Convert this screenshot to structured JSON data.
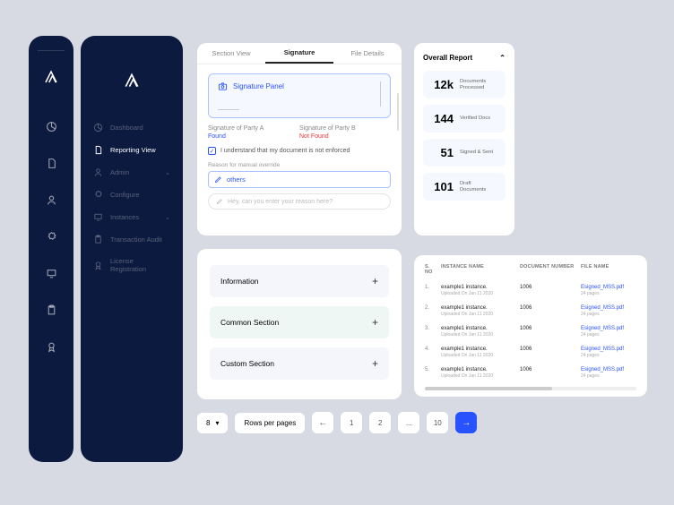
{
  "sidebar": {
    "items": [
      {
        "label": "Dashboard"
      },
      {
        "label": "Reporting View"
      },
      {
        "label": "Admin"
      },
      {
        "label": "Configure"
      },
      {
        "label": "Instances"
      },
      {
        "label": "Transaction Audit"
      },
      {
        "label": "License Registration"
      }
    ]
  },
  "signature": {
    "tabs": {
      "section": "Section View",
      "signature": "Signature",
      "file": "File Details"
    },
    "panel_label": "Signature Panel",
    "partyA_label": "Signature of Party A",
    "partyA_value": "Found",
    "partyB_label": "Signature of Party B",
    "partyB_value": "Not Found",
    "consent": "I understand that my document is not enforced",
    "reason_label": "Reason for manual override",
    "reason_value": "others",
    "comment_placeholder": "Hey, can you enter your reason here?"
  },
  "report": {
    "title": "Overall Report",
    "stats": [
      {
        "value": "12k",
        "label": "Documents Processed"
      },
      {
        "value": "144",
        "label": "Verified Docs"
      },
      {
        "value": "51",
        "label": "Signed & Sent"
      },
      {
        "value": "101",
        "label": "Draft Documents"
      }
    ]
  },
  "accordion": [
    {
      "label": "Information"
    },
    {
      "label": "Common Section"
    },
    {
      "label": "Custom Section"
    }
  ],
  "table": {
    "headers": {
      "sno": "S. NO",
      "instance": "INSTANCE NAME",
      "docnum": "DOCUMENT NUMBER",
      "filename": "FILE NAME"
    },
    "rows": [
      {
        "n": "1.",
        "name": "example1 instance.",
        "sub": "Uploaded On Jan 11 2020",
        "doc": "1006",
        "file": "Esigned_MSS.pdf",
        "pages": "24 pages"
      },
      {
        "n": "2.",
        "name": "example1 instance.",
        "sub": "Uploaded On Jan 11 2020",
        "doc": "1006",
        "file": "Esigned_MSS.pdf",
        "pages": "24 pages"
      },
      {
        "n": "3.",
        "name": "example1 instance.",
        "sub": "Uploaded On Jan 11 2020",
        "doc": "1006",
        "file": "Esigned_MSS.pdf",
        "pages": "24 pages"
      },
      {
        "n": "4.",
        "name": "example1 instance.",
        "sub": "Uploaded On Jan 11 2020",
        "doc": "1006",
        "file": "Esigned_MSS.pdf",
        "pages": "24 pages"
      },
      {
        "n": "5.",
        "name": "example1 instance.",
        "sub": "Uploaded On Jan 11 2020",
        "doc": "1006",
        "file": "Esigned_MSS.pdf",
        "pages": "24 pages"
      }
    ]
  },
  "pager": {
    "size": "8",
    "label": "Rows per pages",
    "pages": [
      "1",
      "2",
      "...",
      "10"
    ]
  }
}
